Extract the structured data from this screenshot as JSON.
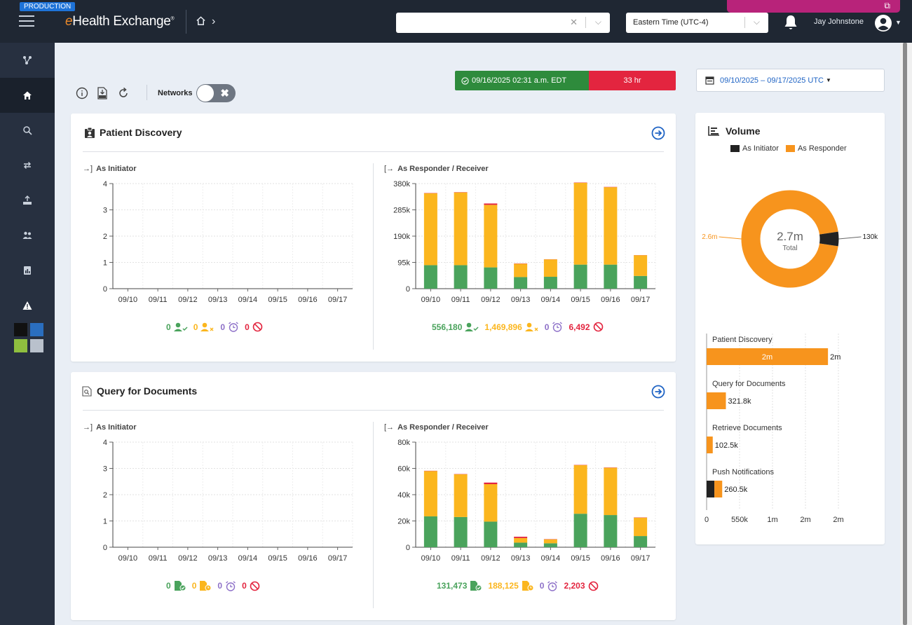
{
  "header": {
    "env_badge": "PRODUCTION",
    "logo_prefix": "e",
    "logo_text": "Health Exchange",
    "logo_mark": "®",
    "search_value": "",
    "timezone": "Eastern Time (UTC-4)",
    "user_name": "Jay Johnstone"
  },
  "toolbar": {
    "networks_label": "Networks",
    "status_ok": "09/16/2025 02:31 a.m. EDT",
    "status_bad": "33 hr",
    "date_range": "09/10/2025 – 09/17/2025 UTC"
  },
  "colors": {
    "success": "#4aa35c",
    "pending": "#fbb61e",
    "timeout": "#8d70c8",
    "error": "#e3253f",
    "initiator": "#222222",
    "responder": "#f7941d"
  },
  "patient_discovery": {
    "title": "Patient Discovery",
    "initiator_label": "As Initiator",
    "responder_label": "As Responder / Receiver",
    "initiator_counts": {
      "success": "0",
      "pending": "0",
      "timeout": "0",
      "error": "0"
    },
    "responder_counts": {
      "success": "556,180",
      "pending": "1,469,896",
      "timeout": "0",
      "error": "6,492"
    }
  },
  "query_documents": {
    "title": "Query for Documents",
    "initiator_label": "As Initiator",
    "responder_label": "As Responder / Receiver",
    "initiator_counts": {
      "success": "0",
      "pending": "0",
      "timeout": "0",
      "error": "0"
    },
    "responder_counts": {
      "success": "131,473",
      "pending": "188,125",
      "timeout": "0",
      "error": "2,203"
    }
  },
  "volume": {
    "title": "Volume",
    "legend_initiator": "As Initiator",
    "legend_responder": "As Responder"
  },
  "chart_data": [
    {
      "id": "pd-initiator",
      "type": "bar",
      "categories": [
        "09/10",
        "09/11",
        "09/12",
        "09/13",
        "09/14",
        "09/15",
        "09/16",
        "09/17"
      ],
      "y_ticks": [
        "0",
        "1",
        "2",
        "3",
        "4"
      ],
      "ylim": [
        0,
        4
      ],
      "grid": true,
      "series": [
        {
          "color": "#4aa35c",
          "values": [
            0,
            0,
            0,
            0,
            0,
            0,
            0,
            0
          ]
        },
        {
          "color": "#fbb61e",
          "values": [
            0,
            0,
            0,
            0,
            0,
            0,
            0,
            0
          ]
        },
        {
          "color": "#e3253f",
          "values": [
            0,
            0,
            0,
            0,
            0,
            0,
            0,
            0
          ]
        }
      ]
    },
    {
      "id": "pd-responder",
      "type": "bar",
      "stacked": true,
      "categories": [
        "09/10",
        "09/11",
        "09/12",
        "09/13",
        "09/14",
        "09/15",
        "09/16",
        "09/17"
      ],
      "y_ticks": [
        "0",
        "95k",
        "190k",
        "285k",
        "380k"
      ],
      "ylim": [
        0,
        380000
      ],
      "grid": true,
      "series": [
        {
          "color": "#4aa35c",
          "values": [
            85000,
            85000,
            77000,
            42000,
            43000,
            87000,
            87000,
            46000
          ]
        },
        {
          "color": "#fbb61e",
          "values": [
            260000,
            263000,
            226000,
            48000,
            63000,
            296000,
            280000,
            75000
          ]
        },
        {
          "color": "#e3253f",
          "values": [
            1000,
            1000,
            5000,
            1000,
            500,
            1000,
            1000,
            500
          ]
        }
      ]
    },
    {
      "id": "qd-initiator",
      "type": "bar",
      "categories": [
        "09/10",
        "09/11",
        "09/12",
        "09/13",
        "09/14",
        "09/15",
        "09/16",
        "09/17"
      ],
      "y_ticks": [
        "0",
        "1",
        "2",
        "3",
        "4"
      ],
      "ylim": [
        0,
        4
      ],
      "grid": true,
      "series": [
        {
          "color": "#4aa35c",
          "values": [
            0,
            0,
            0,
            0,
            0,
            0,
            0,
            0
          ]
        },
        {
          "color": "#fbb61e",
          "values": [
            0,
            0,
            0,
            0,
            0,
            0,
            0,
            0
          ]
        },
        {
          "color": "#e3253f",
          "values": [
            0,
            0,
            0,
            0,
            0,
            0,
            0,
            0
          ]
        }
      ]
    },
    {
      "id": "qd-responder",
      "type": "bar",
      "stacked": true,
      "categories": [
        "09/10",
        "09/11",
        "09/12",
        "09/13",
        "09/14",
        "09/15",
        "09/16",
        "09/17"
      ],
      "y_ticks": [
        "0",
        "20k",
        "40k",
        "60k",
        "80k"
      ],
      "ylim": [
        0,
        80000
      ],
      "grid": true,
      "series": [
        {
          "color": "#4aa35c",
          "values": [
            23500,
            23000,
            19500,
            3500,
            3000,
            25500,
            24500,
            8500
          ]
        },
        {
          "color": "#fbb61e",
          "values": [
            34500,
            32500,
            28500,
            3500,
            3000,
            37000,
            36000,
            14000
          ]
        },
        {
          "color": "#e3253f",
          "values": [
            200,
            200,
            1200,
            1000,
            200,
            200,
            200,
            200
          ]
        }
      ]
    },
    {
      "id": "volume-donut",
      "type": "pie",
      "donut": true,
      "center_value": "2.7m",
      "center_label": "Total",
      "slices": [
        {
          "name": "As Responder",
          "value": 2600000,
          "label": "2.6m",
          "color": "#f7941d"
        },
        {
          "name": "As Initiator",
          "value": 130000,
          "label": "130k",
          "color": "#222222"
        }
      ]
    },
    {
      "id": "volume-bars",
      "type": "bar",
      "orientation": "horizontal",
      "stacked": true,
      "categories": [
        "Patient Discovery",
        "Query for Documents",
        "Retrieve Documents",
        "Push Notifications"
      ],
      "inner_labels": [
        "2m",
        "",
        "",
        ""
      ],
      "value_labels": [
        "2m",
        "321.8k",
        "102.5k",
        "260.5k"
      ],
      "x_ticks": [
        "0",
        "550k",
        "1m",
        "2m",
        "2m"
      ],
      "xlim": [
        0,
        2200000
      ],
      "series": [
        {
          "name": "As Initiator",
          "color": "#222222",
          "values": [
            0,
            0,
            0,
            130000
          ]
        },
        {
          "name": "As Responder",
          "color": "#f7941d",
          "values": [
            2026000,
            321800,
            102500,
            130500
          ]
        }
      ]
    }
  ]
}
